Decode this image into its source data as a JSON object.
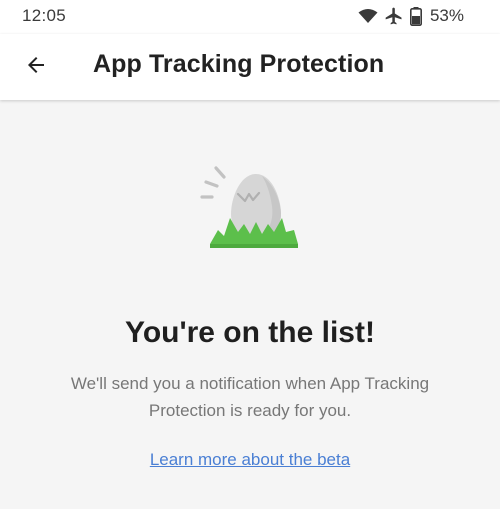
{
  "status_bar": {
    "time": "12:05",
    "battery": "53%",
    "icons": [
      "wifi-icon",
      "airplane-icon",
      "battery-icon"
    ]
  },
  "app_bar": {
    "title": "App Tracking Protection",
    "back_icon": "back-arrow-icon"
  },
  "main": {
    "illustration": "egg-in-grass-illustration",
    "headline": "You're on the list!",
    "body": "We'll send you a notification when App Tracking Protection is ready for you.",
    "link": "Learn more about the beta"
  },
  "colors": {
    "link": "#4a7fd4",
    "grass": "#5cbf4b",
    "egg": "#d6d6d6",
    "background": "#f5f5f5"
  }
}
